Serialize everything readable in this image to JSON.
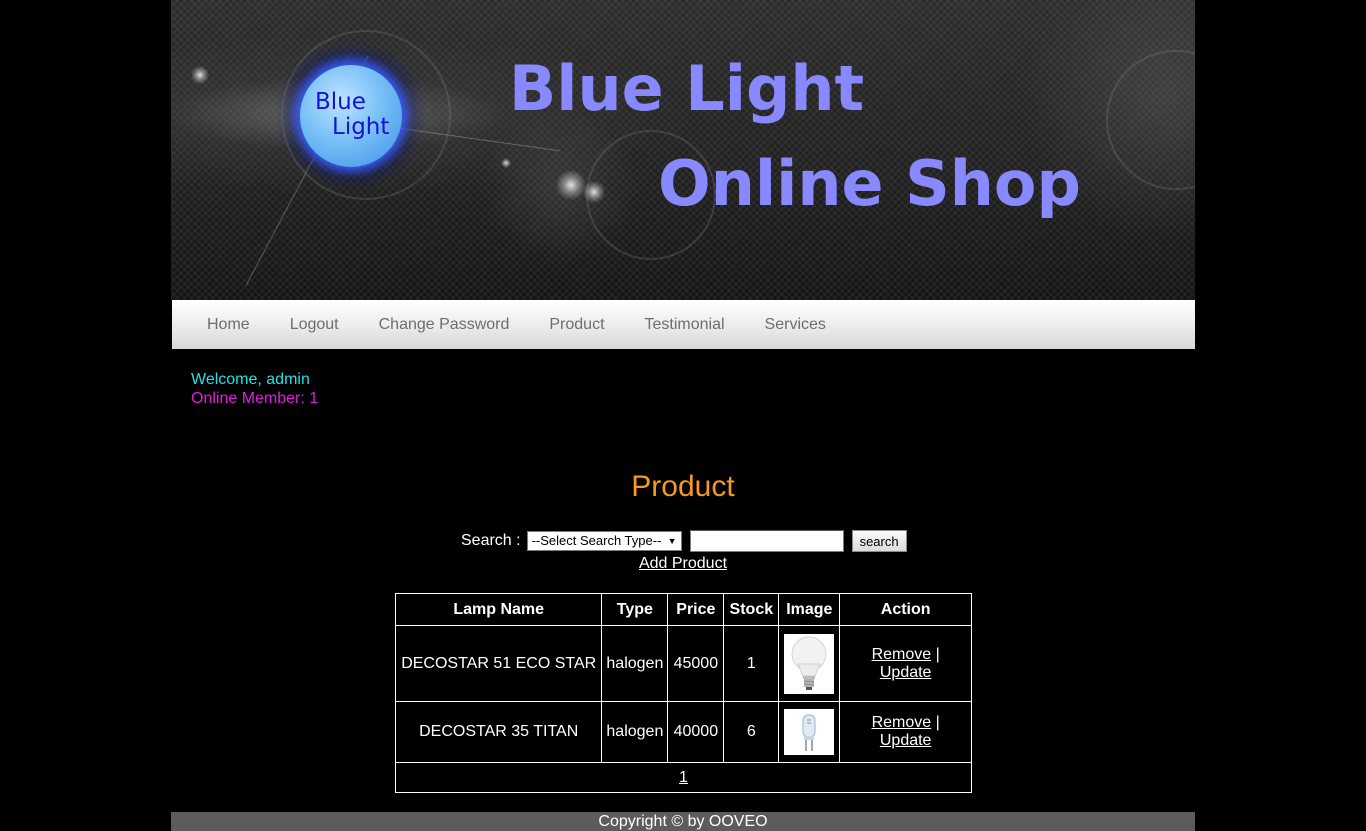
{
  "header": {
    "logo_line1": "Blue",
    "logo_line2": "Light",
    "title_line1": "Blue Light",
    "title_line2": "Online Shop"
  },
  "nav": {
    "items": [
      {
        "label": "Home"
      },
      {
        "label": "Logout"
      },
      {
        "label": "Change Password"
      },
      {
        "label": "Product"
      },
      {
        "label": "Testimonial"
      },
      {
        "label": "Services"
      }
    ]
  },
  "status": {
    "welcome": "Welcome, admin",
    "online_members": "Online Member: 1"
  },
  "main": {
    "title": "Product",
    "search": {
      "label": "Search :",
      "select_value": "--Select Search Type--",
      "input_value": "",
      "button_label": "search"
    },
    "add_product_label": "Add Product",
    "table": {
      "columns": [
        "Lamp Name",
        "Type",
        "Price",
        "Stock",
        "Image",
        "Action"
      ],
      "rows": [
        {
          "name": "DECOSTAR 51 ECO STAR",
          "type": "halogen",
          "price": "45000",
          "stock": "1",
          "image": "led-bulb-image",
          "remove": "Remove",
          "separator": "|",
          "update": "Update"
        },
        {
          "name": "DECOSTAR 35 TITAN",
          "type": "halogen",
          "price": "40000",
          "stock": "6",
          "image": "halogen-capsule-image",
          "remove": "Remove",
          "separator": "|",
          "update": "Update"
        }
      ],
      "pagination": [
        "1"
      ]
    }
  },
  "footer": {
    "copyright": "Copyright © by OOVEO"
  },
  "colors": {
    "title_text": "#8888ff",
    "logo_text": "#1612d6",
    "welcome": "#20e4e4",
    "online": "#e21ce2",
    "page_title": "#f7991e",
    "footer_bg": "#5c5c5c"
  }
}
